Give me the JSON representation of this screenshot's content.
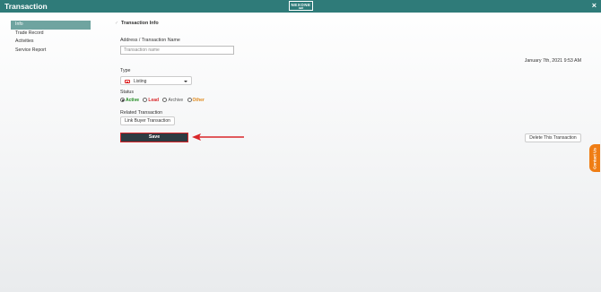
{
  "window": {
    "title": "Transaction",
    "logo_text": "NEXONE",
    "logo_sub": "ABR"
  },
  "sidebar": {
    "items": [
      {
        "label": "Info",
        "active": true
      },
      {
        "label": "Trade Record",
        "active": false
      },
      {
        "label": "Activities",
        "active": false
      },
      {
        "label": "Service Report",
        "active": false
      }
    ]
  },
  "main": {
    "section_title": "Transaction Info",
    "address_label": "Address / Transaction Name",
    "address_placeholder": "Transaction name",
    "address_value": "",
    "date": "January 7th, 2021 9:53 AM",
    "type_label": "Type",
    "type_value": "Listing",
    "status_label": "Status",
    "status_options": [
      {
        "label": "Active",
        "color": "#1e8a1e",
        "checked": true
      },
      {
        "label": "Lead",
        "color": "#d9262a",
        "checked": false
      },
      {
        "label": "Archive",
        "color": "#555555",
        "checked": false
      },
      {
        "label": "Other",
        "color": "#e08a1e",
        "checked": false
      }
    ],
    "related_label": "Related Transaction",
    "link_buyer_label": "Link Buyer Transaction",
    "save_label": "Save",
    "delete_label": "Delete This Transaction"
  },
  "contact_tab": {
    "label": "Contact Us",
    "color": "#ef7d14"
  },
  "colors": {
    "header": "#2f7b79",
    "sidebar_active": "#6fa4a0",
    "save_bg": "#2e3b42",
    "highlight": "#d9262a"
  }
}
